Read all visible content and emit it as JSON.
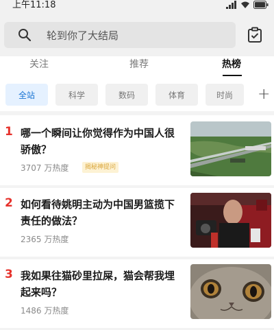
{
  "status_bar": {
    "time": "上午11:18"
  },
  "search": {
    "placeholder": "轮到你了大结局"
  },
  "tabs": [
    {
      "label": "关注"
    },
    {
      "label": "推荐"
    },
    {
      "label": "热榜"
    }
  ],
  "active_tab": "热榜",
  "chips": [
    {
      "label": "全站"
    },
    {
      "label": "科学"
    },
    {
      "label": "数码"
    },
    {
      "label": "体育"
    },
    {
      "label": "时尚"
    }
  ],
  "active_chip": "全站",
  "plus": "+",
  "hot_list": [
    {
      "rank": "1",
      "title": "哪一个瞬间让你觉得作为中国人很骄傲？",
      "heat": "3707 万热度",
      "badge": "揭秘神提问"
    },
    {
      "rank": "2",
      "title": "如何看待姚明主动为中国男篮揽下责任的做法？",
      "heat": "2365 万热度"
    },
    {
      "rank": "3",
      "title": "我如果往猫砂里拉屎，猫会帮我埋起来吗？",
      "heat": "1486 万热度"
    }
  ],
  "colors": {
    "accent_red": "#e6322c",
    "chip_active": "#1873d3",
    "badge_text": "#d9a53a"
  }
}
